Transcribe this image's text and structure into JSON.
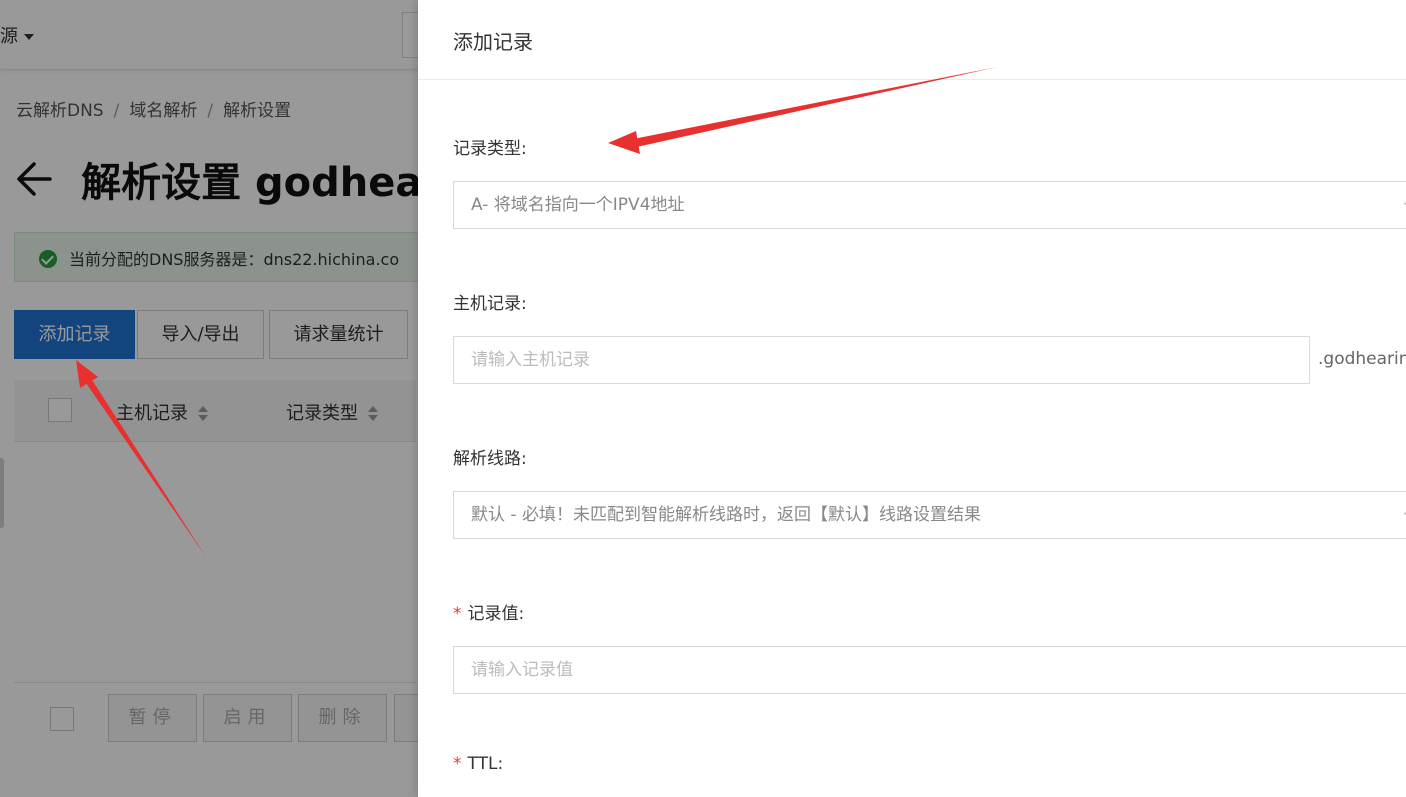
{
  "topbar": {
    "resource_label": "源"
  },
  "breadcrumb": {
    "items": [
      "云解析DNS",
      "域名解析",
      "解析设置"
    ]
  },
  "page": {
    "title": "解析设置 godhear"
  },
  "notice": {
    "text": "当前分配的DNS服务器是：dns22.hichina.co"
  },
  "toolbar": {
    "add_record": "添加记录",
    "import_export": "导入/导出",
    "request_stats": "请求量统计"
  },
  "table": {
    "columns": [
      "主机记录",
      "记录类型"
    ]
  },
  "bottom_actions": {
    "pause": "暂停",
    "enable": "启用",
    "delete": "删除"
  },
  "drawer": {
    "title": "添加记录",
    "record_type": {
      "label": "记录类型:",
      "value": "A- 将域名指向一个IPV4地址"
    },
    "host": {
      "label": "主机记录:",
      "placeholder": "请输入主机记录",
      "suffix": ".godhearing"
    },
    "line": {
      "label": "解析线路:",
      "value": "默认 - 必填！未匹配到智能解析线路时，返回【默认】线路设置结果"
    },
    "value": {
      "required_mark": "*",
      "label": "记录值:",
      "placeholder": "请输入记录值"
    },
    "ttl": {
      "required_mark": "*",
      "label": "TTL:"
    }
  },
  "colors": {
    "primary": "#1f74d3",
    "annotation_arrow": "#e8302f",
    "success": "#2a9d3c",
    "required": "#e4393c"
  }
}
